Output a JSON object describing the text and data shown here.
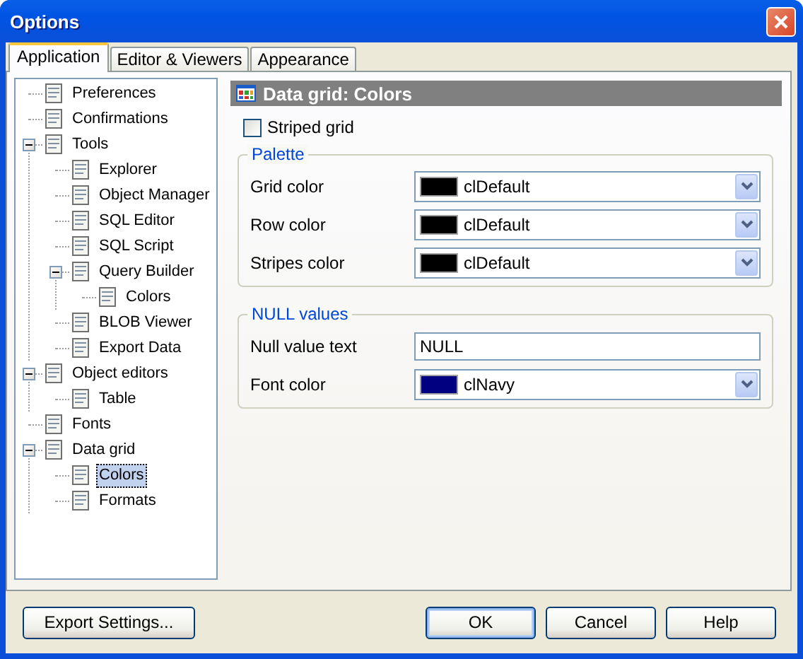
{
  "window": {
    "title": "Options"
  },
  "tabs": [
    {
      "label": "Application",
      "selected": true
    },
    {
      "label": "Editor & Viewers",
      "selected": false
    },
    {
      "label": "Appearance",
      "selected": false
    }
  ],
  "tree": [
    {
      "label": "Preferences",
      "selected": false
    },
    {
      "label": "Confirmations",
      "selected": false
    },
    {
      "label": "Tools",
      "selected": false,
      "expanded": true,
      "children": [
        {
          "label": "Explorer",
          "selected": false
        },
        {
          "label": "Object Manager",
          "selected": false
        },
        {
          "label": "SQL Editor",
          "selected": false
        },
        {
          "label": "SQL Script",
          "selected": false
        },
        {
          "label": "Query Builder",
          "selected": false,
          "expanded": true,
          "children": [
            {
              "label": "Colors",
              "selected": false
            }
          ]
        },
        {
          "label": "BLOB Viewer",
          "selected": false
        },
        {
          "label": "Export Data",
          "selected": false
        }
      ]
    },
    {
      "label": "Object editors",
      "selected": false,
      "expanded": true,
      "children": [
        {
          "label": "Table",
          "selected": false
        }
      ]
    },
    {
      "label": "Fonts",
      "selected": false
    },
    {
      "label": "Data grid",
      "selected": false,
      "expanded": true,
      "children": [
        {
          "label": "Colors",
          "selected": true
        },
        {
          "label": "Formats",
          "selected": false
        }
      ]
    }
  ],
  "page": {
    "title": "Data grid: Colors",
    "striped_grid": {
      "label": "Striped grid",
      "checked": false
    },
    "groups": [
      {
        "title": "Palette",
        "rows": [
          {
            "kind": "color",
            "label": "Grid color",
            "value": "clDefault",
            "color": "#000000"
          },
          {
            "kind": "color",
            "label": "Row color",
            "value": "clDefault",
            "color": "#000000"
          },
          {
            "kind": "color",
            "label": "Stripes color",
            "value": "clDefault",
            "color": "#000000"
          }
        ]
      },
      {
        "title": "NULL values",
        "rows": [
          {
            "kind": "text",
            "label": "Null value text",
            "value": "NULL"
          },
          {
            "kind": "color",
            "label": "Font color",
            "value": "clNavy",
            "color": "#000080"
          }
        ]
      }
    ]
  },
  "buttons": {
    "left": [
      {
        "label": "Export Settings...",
        "default": false
      }
    ],
    "right": [
      {
        "label": "OK",
        "default": true
      },
      {
        "label": "Cancel",
        "default": false
      },
      {
        "label": "Help",
        "default": false
      }
    ]
  }
}
